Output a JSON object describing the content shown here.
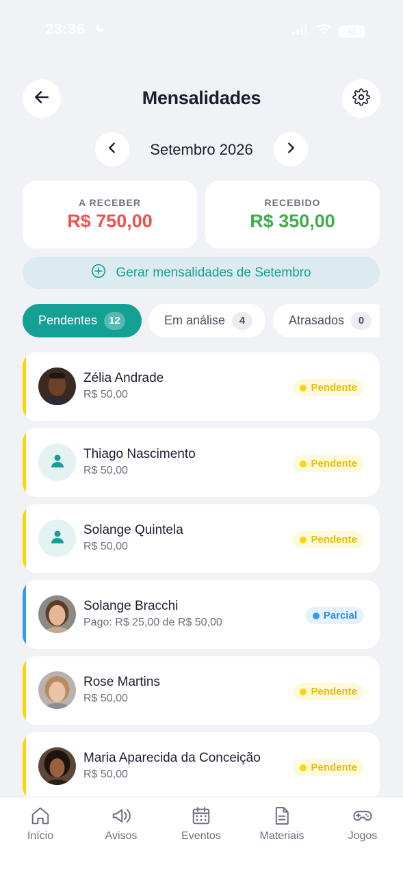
{
  "status_bar": {
    "time": "23:36",
    "battery": "41"
  },
  "header": {
    "title": "Mensalidades"
  },
  "month_nav": {
    "label": "Setembro 2026"
  },
  "summary": {
    "to_receive_label": "A RECEBER",
    "to_receive_value": "R$ 750,00",
    "received_label": "RECEBIDO",
    "received_value": "R$ 350,00",
    "to_receive_color": "#F0514F",
    "received_color": "#3EAD4B"
  },
  "generate_button": {
    "label": "Gerar mensalidades de Setembro"
  },
  "tabs": [
    {
      "label": "Pendentes",
      "count": "12",
      "active": true
    },
    {
      "label": "Em análise",
      "count": "4",
      "active": false
    },
    {
      "label": "Atrasados",
      "count": "0",
      "active": false
    }
  ],
  "payments": [
    {
      "name": "Zélia Andrade",
      "amount": "R$ 50,00",
      "status": "Pendente",
      "avatar": "photo"
    },
    {
      "name": "Thiago Nascimento",
      "amount": "R$ 50,00",
      "status": "Pendente",
      "avatar": "placeholder-user-icon"
    },
    {
      "name": "Solange Quintela",
      "amount": "R$ 50,00",
      "status": "Pendente",
      "avatar": "placeholder-user-icon"
    },
    {
      "name": "Solange Bracchi",
      "amount": "Pago: R$ 25,00 de R$ 50,00",
      "status": "Parcial",
      "avatar": "photo"
    },
    {
      "name": "Rose Martins",
      "amount": "R$ 50,00",
      "status": "Pendente",
      "avatar": "photo"
    },
    {
      "name": "Maria Aparecida da Conceição",
      "amount": "R$ 50,00",
      "status": "Pendente",
      "avatar": "photo"
    }
  ],
  "bottom_nav": [
    {
      "label": "Início",
      "icon": "home-icon"
    },
    {
      "label": "Avisos",
      "icon": "megaphone-icon"
    },
    {
      "label": "Eventos",
      "icon": "calendar-icon"
    },
    {
      "label": "Materiais",
      "icon": "document-icon"
    },
    {
      "label": "Jogos",
      "icon": "gamepad-icon"
    }
  ],
  "colors": {
    "accent": "#14A095",
    "pending": "#FFD400",
    "partial": "#2F9CF0",
    "background": "#F1F2F6"
  }
}
